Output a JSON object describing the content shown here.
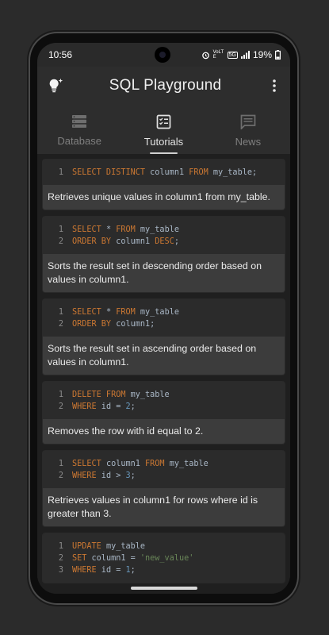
{
  "status": {
    "time": "10:56",
    "network": "VoLTE",
    "signal_label": "5G",
    "battery": "19%"
  },
  "appbar": {
    "title": "SQL Playground",
    "left_icon": "lightbulb-icon",
    "right_icon": "more-vert-icon"
  },
  "tabs": [
    {
      "label": "Database",
      "icon": "database-icon",
      "active": false
    },
    {
      "label": "Tutorials",
      "icon": "tutorials-icon",
      "active": true
    },
    {
      "label": "News",
      "icon": "news-icon",
      "active": false
    }
  ],
  "tutorials": [
    {
      "lines": [
        [
          [
            "kw",
            "SELECT DISTINCT"
          ],
          [
            "id",
            " column1 "
          ],
          [
            "kw",
            "FROM"
          ],
          [
            "id",
            " my_table;"
          ]
        ]
      ],
      "description": "Retrieves unique values in column1 from my_table."
    },
    {
      "lines": [
        [
          [
            "kw",
            "SELECT"
          ],
          [
            "id",
            " * "
          ],
          [
            "kw",
            "FROM"
          ],
          [
            "id",
            " my_table"
          ]
        ],
        [
          [
            "kw",
            "ORDER BY"
          ],
          [
            "id",
            " column1 "
          ],
          [
            "kw",
            "DESC"
          ],
          [
            "id",
            ";"
          ]
        ]
      ],
      "description": "Sorts the result set in descending order based on values in column1."
    },
    {
      "lines": [
        [
          [
            "kw",
            "SELECT"
          ],
          [
            "id",
            " * "
          ],
          [
            "kw",
            "FROM"
          ],
          [
            "id",
            " my_table"
          ]
        ],
        [
          [
            "kw",
            "ORDER BY"
          ],
          [
            "id",
            " column1;"
          ]
        ]
      ],
      "description": "Sorts the result set in ascending order based on values in column1."
    },
    {
      "lines": [
        [
          [
            "kw",
            "DELETE FROM"
          ],
          [
            "id",
            " my_table"
          ]
        ],
        [
          [
            "kw",
            "WHERE"
          ],
          [
            "id",
            " id = "
          ],
          [
            "num",
            "2"
          ],
          [
            "id",
            ";"
          ]
        ]
      ],
      "description": "Removes the row with id equal to 2."
    },
    {
      "lines": [
        [
          [
            "kw",
            "SELECT"
          ],
          [
            "id",
            " column1 "
          ],
          [
            "kw",
            "FROM"
          ],
          [
            "id",
            " my_table"
          ]
        ],
        [
          [
            "kw",
            "WHERE"
          ],
          [
            "id",
            " id > "
          ],
          [
            "num",
            "3"
          ],
          [
            "id",
            ";"
          ]
        ]
      ],
      "description": "Retrieves values in column1 for rows where id is greater than 3."
    },
    {
      "lines": [
        [
          [
            "kw",
            "UPDATE"
          ],
          [
            "id",
            " my_table"
          ]
        ],
        [
          [
            "kw",
            "SET"
          ],
          [
            "id",
            " column1 = "
          ],
          [
            "str",
            "'new_value'"
          ]
        ],
        [
          [
            "kw",
            "WHERE"
          ],
          [
            "id",
            " id = "
          ],
          [
            "num",
            "1"
          ],
          [
            "id",
            ";"
          ]
        ]
      ],
      "description": ""
    }
  ]
}
